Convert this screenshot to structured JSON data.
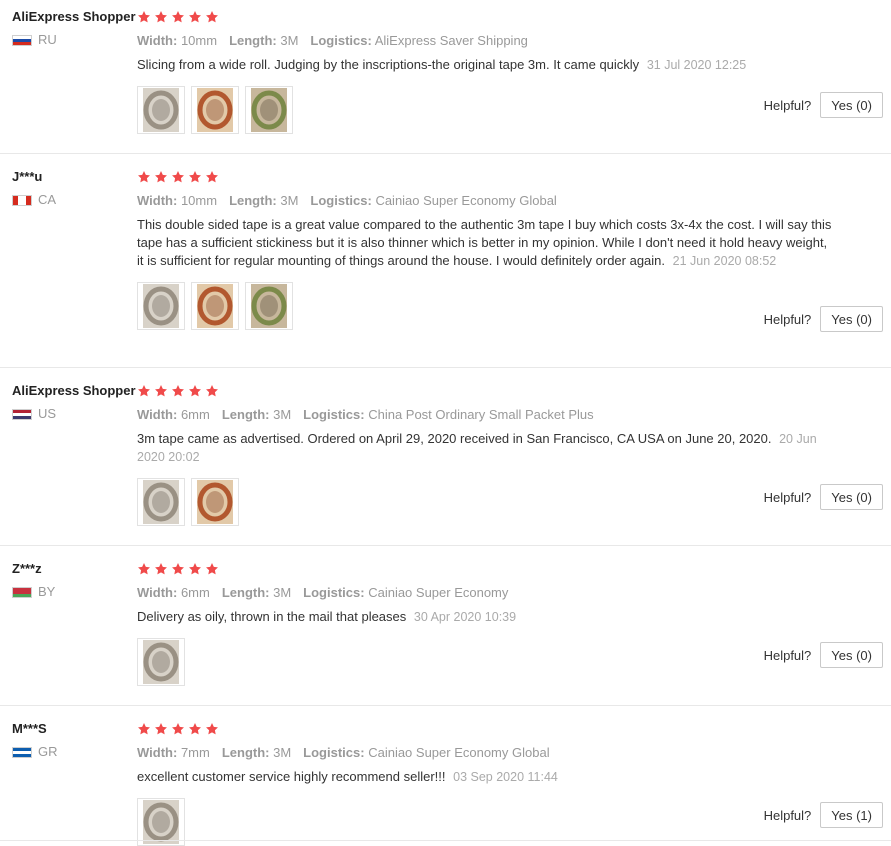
{
  "labels": {
    "width": "Width:",
    "length": "Length:",
    "logistics": "Logistics:",
    "helpful": "Helpful?"
  },
  "reviews": [
    {
      "user": "AliExpress Shopper",
      "country": "RU",
      "flag": [
        "#ffffff",
        "#1c4ba8",
        "#d52b1e"
      ],
      "rating": 5,
      "width": "10mm",
      "length": "3M",
      "logistics": "AliExpress Saver Shipping",
      "text": "Slicing from a wide roll. Judging by the inscriptions-the original tape 3m. It came quickly",
      "date": "31 Jul 2020 12:25",
      "photos": [
        "tape roll",
        "tape roll",
        "tape roll"
      ],
      "helpful": "Yes (0)"
    },
    {
      "user": "J***u",
      "country": "CA",
      "flag": [
        "#d52b1e",
        "#ffffff",
        "#d52b1e"
      ],
      "rating": 5,
      "width": "10mm",
      "length": "3M",
      "logistics": "Cainiao Super Economy Global",
      "text": "This double sided tape is a great value compared to the authentic 3m tape I buy which costs 3x-4x the cost. I will say this tape has a sufficient stickiness but it is also thinner which is better in my opinion. While I don't need it hold heavy weight, it is sufficient for regular mounting of things around the house. I would definitely order again.",
      "date": "21 Jun 2020 08:52",
      "photos": [
        "tape roll",
        "tape roll",
        "tape roll"
      ],
      "helpful": "Yes (0)"
    },
    {
      "user": "AliExpress Shopper",
      "country": "US",
      "flag": [
        "#b22234",
        "#ffffff",
        "#3c3b6e"
      ],
      "rating": 5,
      "width": "6mm",
      "length": "3M",
      "logistics": "China Post Ordinary Small Packet Plus",
      "text": "3m tape came as advertised. Ordered on April 29, 2020 received in San Francisco, CA USA on June 20, 2020.",
      "date": "20 Jun 2020 20:02",
      "photos": [
        "tape roll",
        "tape roll"
      ],
      "helpful": "Yes (0)"
    },
    {
      "user": "Z***z",
      "country": "BY",
      "flag": [
        "#c8313e",
        "#c8313e",
        "#4aa657"
      ],
      "rating": 5,
      "width": "6mm",
      "length": "3M",
      "logistics": "Cainiao Super Economy",
      "text": "Delivery as oily, thrown in the mail that pleases",
      "date": "30 Apr 2020 10:39",
      "photos": [
        "tape roll"
      ],
      "helpful": "Yes (0)"
    },
    {
      "user": "M***S",
      "country": "GR",
      "flag": [
        "#0d5eaf",
        "#ffffff",
        "#0d5eaf"
      ],
      "rating": 5,
      "width": "7mm",
      "length": "3M",
      "logistics": "Cainiao Super Economy Global",
      "text": "excellent customer service highly recommend seller!!!",
      "date": "03 Sep 2020 11:44",
      "photos": [
        "tape roll"
      ],
      "helpful": "Yes (1)"
    }
  ],
  "colors": {
    "star": "#f04a4a",
    "divider": "#e8e8e8",
    "meta_text": "#999999"
  }
}
